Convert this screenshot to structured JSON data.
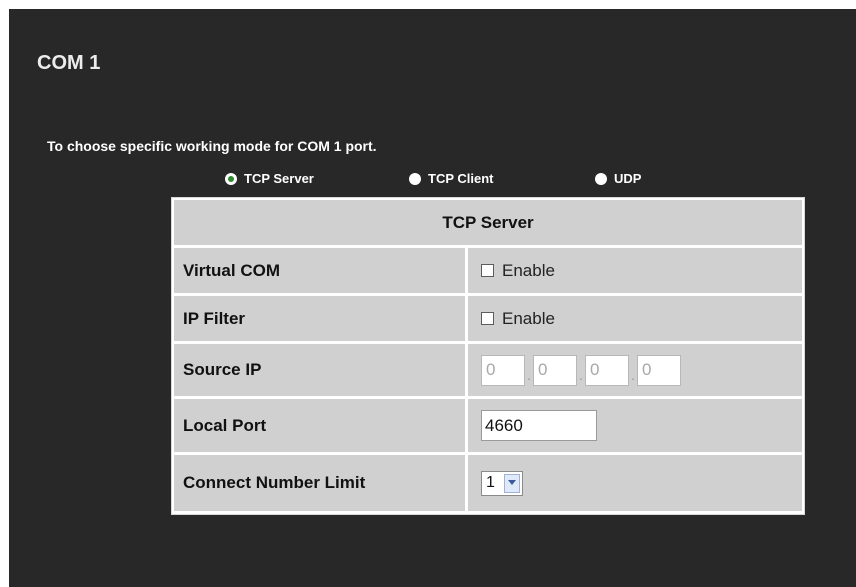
{
  "page": {
    "title": "COM 1",
    "description": "To choose specific working mode for COM 1 port."
  },
  "modes": [
    {
      "label": "TCP Server",
      "selected": true
    },
    {
      "label": "TCP Client",
      "selected": false
    },
    {
      "label": "UDP",
      "selected": false
    }
  ],
  "settings": {
    "header": "TCP Server",
    "virtual_com": {
      "label": "Virtual COM",
      "option": "Enable",
      "checked": false
    },
    "ip_filter": {
      "label": "IP Filter",
      "option": "Enable",
      "checked": false
    },
    "source_ip": {
      "label": "Source IP",
      "octets": [
        "0",
        "0",
        "0",
        "0"
      ]
    },
    "local_port": {
      "label": "Local Port",
      "value": "4660"
    },
    "connect_limit": {
      "label": "Connect Number Limit",
      "value": "1"
    }
  },
  "colors": {
    "panel_bg": "#282828",
    "table_bg": "#d0d0d0",
    "radio_selected": "#2e8b2e"
  }
}
